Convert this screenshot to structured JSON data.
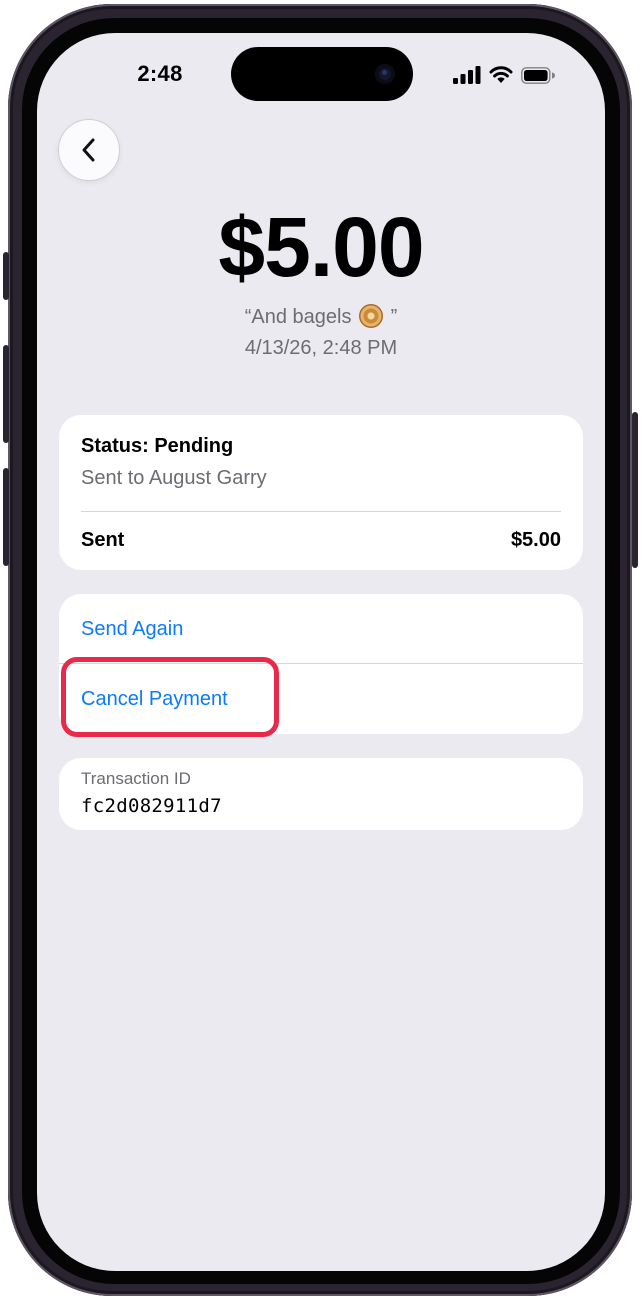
{
  "status_bar": {
    "time": "2:48",
    "icons": [
      "cellular-signal-icon",
      "wifi-icon",
      "battery-icon"
    ]
  },
  "navigation": {
    "back_icon": "chevron-left-icon"
  },
  "payment": {
    "amount": "$5.00",
    "memo_open": "“And bagels",
    "memo_emoji": "bagel-emoji",
    "memo_close": "”",
    "date": "4/13/26, 2:48 PM"
  },
  "status_card": {
    "title": "Status: Pending",
    "subtitle": "Sent to August Garry",
    "sent_label": "Sent",
    "sent_value": "$5.00"
  },
  "actions": {
    "send_again": "Send Again",
    "cancel_payment": "Cancel Payment"
  },
  "transaction": {
    "label": "Transaction ID",
    "id": "fc2d082911d7"
  },
  "colors": {
    "background": "#ebeaf0",
    "card": "#ffffff",
    "link": "#0a7aff",
    "secondary_text": "#6c6c72",
    "highlight": "#e8294a"
  }
}
